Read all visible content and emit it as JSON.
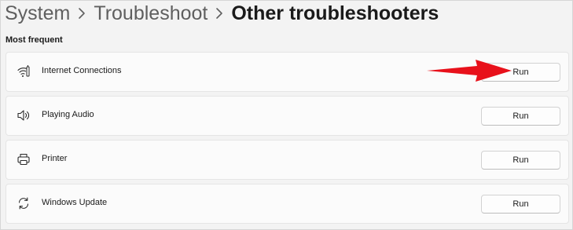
{
  "breadcrumb": {
    "items": [
      "System",
      "Troubleshoot",
      "Other troubleshooters"
    ]
  },
  "section": {
    "title": "Most frequent"
  },
  "troubleshooters": [
    {
      "label": "Internet Connections",
      "icon": "wifi-icon",
      "button": "Run"
    },
    {
      "label": "Playing Audio",
      "icon": "speaker-icon",
      "button": "Run"
    },
    {
      "label": "Printer",
      "icon": "printer-icon",
      "button": "Run"
    },
    {
      "label": "Windows Update",
      "icon": "sync-icon",
      "button": "Run"
    }
  ],
  "annotation": {
    "type": "red-arrow",
    "color": "#e8111b",
    "points_to": "Internet Connections Run button"
  }
}
